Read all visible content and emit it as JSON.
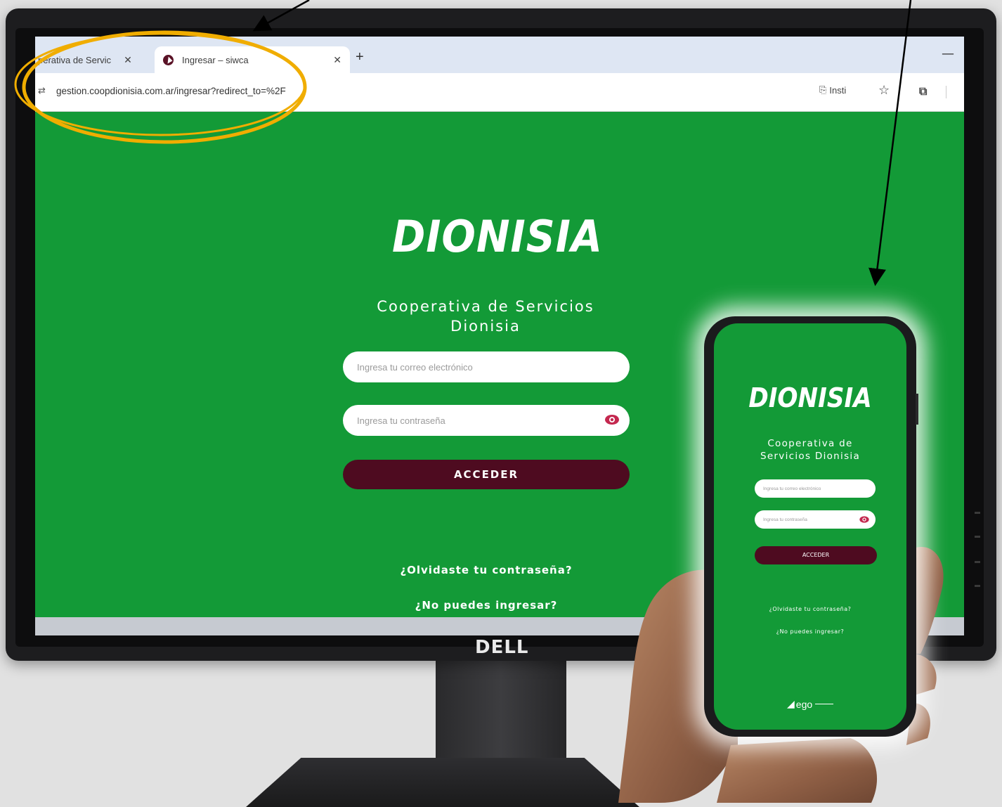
{
  "browser": {
    "tabs": [
      {
        "label": "perativa de Servic"
      },
      {
        "label": "Ingresar – siwca"
      }
    ],
    "new_tab_label": "+",
    "url": "gestion.coopdionisia.com.ar/ingresar?redirect_to=%2F",
    "install_label": "Insti"
  },
  "page": {
    "logo_text": "DIONISIA",
    "org_name": "Cooperativa de Servicios Dionisia",
    "email_placeholder": "Ingresa tu correo electrónico",
    "password_placeholder": "Ingresa tu contraseña",
    "access_button": "ACCEDER",
    "forgot_link": "¿Olvidaste tu contraseña?",
    "noaccess_link": "¿No puedes ingresar?"
  },
  "monitor": {
    "brand": "DELL"
  },
  "phone": {
    "logo_text": "DIONISIA",
    "org_name": "Cooperativa de Servicios Dionisia",
    "email_placeholder": "Ingresa tu correo electrónico",
    "password_placeholder": "Ingresa tu contraseña",
    "access_button": "ACCEDER",
    "forgot_link": "¿Olvidaste tu contraseña?",
    "noaccess_link": "¿No puedes ingresar?",
    "footer_brand": "ego"
  },
  "colors": {
    "brand_green": "#139a37",
    "button_maroon": "#4e0b20",
    "highlight_gold": "#f0ad00",
    "eye_red": "#c4284f"
  },
  "icons": [
    "close-icon",
    "favicon",
    "site-info-icon",
    "install-icon",
    "star-icon",
    "extensions-icon",
    "eye-icon",
    "arrow-icon"
  ]
}
